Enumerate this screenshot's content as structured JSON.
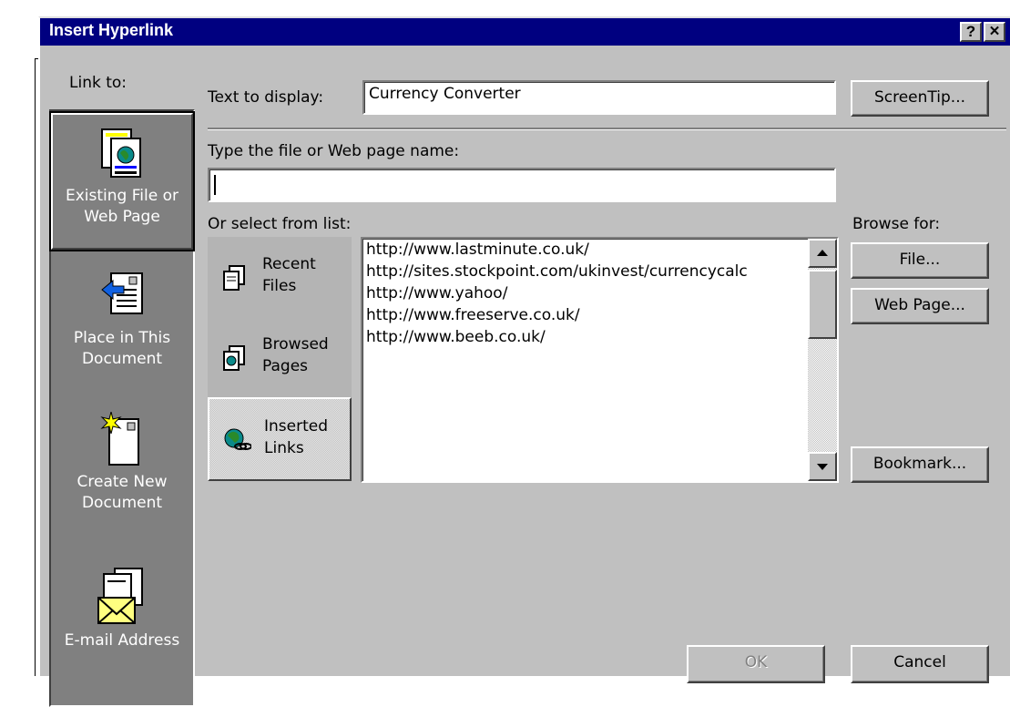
{
  "dialog": {
    "title": "Insert Hyperlink",
    "help_button": "?",
    "close_button": "✕"
  },
  "sidebar": {
    "heading": "Link to:",
    "items": [
      {
        "label": "Existing File or\nWeb Page",
        "icon": "existing-file-icon",
        "selected": true
      },
      {
        "label": "Place in This\nDocument",
        "icon": "place-in-document-icon"
      },
      {
        "label": "Create New\nDocument",
        "icon": "new-document-icon"
      },
      {
        "label": "E-mail Address",
        "icon": "email-icon"
      }
    ]
  },
  "text_to_display": {
    "label": "Text to display:",
    "value": "Currency Converter"
  },
  "screentip_button": "ScreenTip...",
  "filename": {
    "label": "Type the file or Web page name:",
    "value": ""
  },
  "select_list_label": "Or select from list:",
  "browse_for_label": "Browse for:",
  "list_categories": [
    {
      "label": "Recent\nFiles",
      "icon": "recent-files-icon"
    },
    {
      "label": "Browsed\nPages",
      "icon": "browsed-pages-icon"
    },
    {
      "label": "Inserted\nLinks",
      "icon": "inserted-links-icon",
      "selected": true
    }
  ],
  "urls": [
    "http://www.lastminute.co.uk/",
    "http://sites.stockpoint.com/ukinvest/currencycalc",
    "http://www.yahoo/",
    "http://www.freeserve.co.uk/",
    "http://www.beeb.co.uk/"
  ],
  "buttons": {
    "file": "File...",
    "web_page": "Web Page...",
    "bookmark": "Bookmark...",
    "ok": "OK",
    "cancel": "Cancel"
  },
  "colors": {
    "titlebar": "#000080",
    "face": "#c0c0c0",
    "sidebar": "#808080"
  }
}
